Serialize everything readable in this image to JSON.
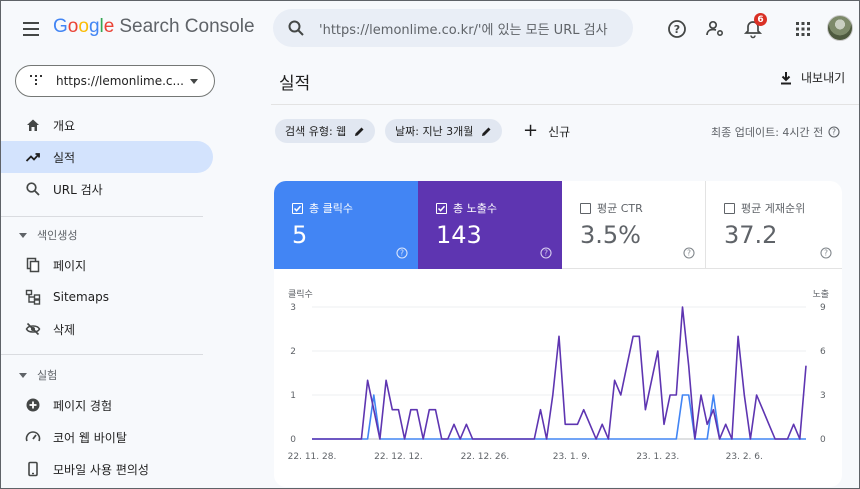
{
  "header": {
    "logo_google": [
      "G",
      "o",
      "o",
      "g",
      "l",
      "e"
    ],
    "logo_product": "Search Console",
    "search_placeholder": "'https://lemonlime.co.kr/'에 있는 모든 URL 검사",
    "notification_count": "6"
  },
  "sidebar": {
    "property": "https://lemonlime.c...",
    "items": [
      {
        "label": "개요",
        "icon": "home-icon"
      },
      {
        "label": "실적",
        "icon": "trending-up-icon",
        "active": true
      },
      {
        "label": "URL 검사",
        "icon": "search-icon"
      }
    ],
    "section_index": "색인생성",
    "index_items": [
      {
        "label": "페이지",
        "icon": "pages-icon"
      },
      {
        "label": "Sitemaps",
        "icon": "sitemap-icon"
      },
      {
        "label": "삭제",
        "icon": "visibility-off-icon"
      }
    ],
    "section_experience": "실험",
    "experience_items": [
      {
        "label": "페이지 경험",
        "icon": "plus-circle-icon"
      },
      {
        "label": "코어 웹 바이탈",
        "icon": "speed-icon"
      },
      {
        "label": "모바일 사용 편의성",
        "icon": "phone-icon"
      }
    ]
  },
  "main": {
    "title": "실적",
    "export_label": "내보내기",
    "filters": [
      {
        "label": "검색 유형: 웹"
      },
      {
        "label": "날짜: 지난 3개월"
      }
    ],
    "new_label": "신규",
    "updated": "최종 업데이트: 4시간 전",
    "metrics": [
      {
        "label": "총 클릭수",
        "value": "5",
        "checked": true,
        "color": "#4285f4"
      },
      {
        "label": "총 노출수",
        "value": "143",
        "checked": true,
        "color": "#5e35b1"
      },
      {
        "label": "평균 CTR",
        "value": "3.5%",
        "checked": false
      },
      {
        "label": "평균 게재순위",
        "value": "37.2",
        "checked": false
      }
    ]
  },
  "chart_data": {
    "type": "line",
    "left_axis_label": "클릭수",
    "right_axis_label": "노출",
    "left_ticks": [
      "0",
      "1",
      "2",
      "3"
    ],
    "right_ticks": [
      "0",
      "3",
      "6",
      "9"
    ],
    "x_ticks": [
      "22. 11. 28.",
      "22. 12. 12.",
      "22. 12. 26.",
      "23. 1. 9.",
      "23. 1. 23.",
      "23. 2. 6."
    ],
    "ylim_left": [
      0,
      3
    ],
    "ylim_right": [
      0,
      9
    ],
    "series": [
      {
        "name": "클릭수",
        "color": "#4285f4",
        "axis": "left",
        "values": [
          0,
          0,
          0,
          0,
          0,
          0,
          0,
          0,
          0,
          0,
          1,
          0,
          0,
          0,
          0,
          0,
          0,
          0,
          0,
          0,
          0,
          0,
          0,
          0,
          0,
          0,
          0,
          0,
          0,
          0,
          0,
          0,
          0,
          0,
          0,
          0,
          0,
          0,
          0,
          0,
          0,
          0,
          0,
          0,
          0,
          0,
          0,
          0,
          0,
          0,
          0,
          0,
          0,
          0,
          0,
          0,
          0,
          0,
          0,
          0,
          1,
          1,
          0,
          0,
          0,
          1,
          0,
          0,
          0,
          0,
          0,
          0,
          0,
          0,
          0,
          0,
          0,
          0,
          0,
          0,
          0
        ]
      },
      {
        "name": "노출",
        "color": "#5e35b1",
        "axis": "right",
        "values": [
          0,
          0,
          0,
          0,
          0,
          0,
          0,
          0,
          0,
          4,
          2,
          0,
          4,
          2,
          2,
          0,
          2,
          2,
          0,
          2,
          2,
          0,
          0,
          1,
          0,
          1,
          0,
          0,
          0,
          0,
          0,
          0,
          0,
          0,
          0,
          0,
          0,
          2,
          0,
          3,
          7,
          1,
          1,
          1,
          2,
          1,
          0,
          1,
          0,
          4,
          3,
          5,
          7,
          7,
          2,
          4,
          6,
          1,
          3,
          3,
          9,
          5,
          0,
          3,
          1,
          2,
          0,
          1,
          0,
          7,
          3,
          0,
          3,
          2,
          1,
          0,
          0,
          0,
          1,
          0,
          5
        ]
      }
    ]
  }
}
